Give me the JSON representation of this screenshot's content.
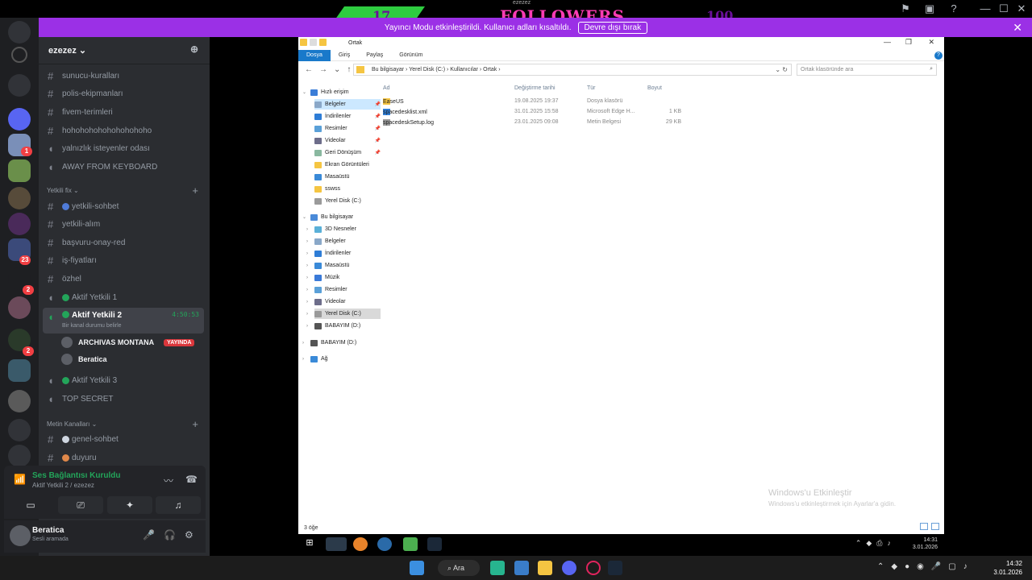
{
  "overlay": {
    "left_count": "17",
    "title": "FOLLOWERS",
    "tag": "ezezez",
    "right_count": "100"
  },
  "notice": {
    "text": "Yayıncı Modu etkinleştirildi. Kullanıcı adları kısaltıldı.",
    "button": "Devre dışı bırak"
  },
  "server": {
    "name": "ezezez"
  },
  "channels": [
    {
      "name": "sunucu-kuralları",
      "type": "text"
    },
    {
      "name": "polis-ekipmanları",
      "type": "text"
    },
    {
      "name": "fivem-terimleri",
      "type": "text"
    },
    {
      "name": "hohohohohohohohohoho",
      "type": "text"
    },
    {
      "name": "yalnızlık isteyenler odası",
      "type": "voice"
    },
    {
      "name": "AWAY FROM KEYBOARD",
      "type": "voice"
    }
  ],
  "category1": "Yetkili fix",
  "channels2": [
    {
      "name": "yetkili-sohbet",
      "type": "text"
    },
    {
      "name": "yetkili-alım",
      "type": "text"
    },
    {
      "name": "başvuru-onay-red",
      "type": "text"
    },
    {
      "name": "iş-fiyatları",
      "type": "text"
    },
    {
      "name": "özhel",
      "type": "text"
    },
    {
      "name": "Aktif Yetkili 1",
      "type": "voice"
    }
  ],
  "active_channel": {
    "name": "Aktif Yetkili 2",
    "time": "4:50:53",
    "status": "Bir kanal durumu belirle"
  },
  "members": [
    {
      "name": "ARCHIVAS MONTANA",
      "live": "YAYINDA"
    },
    {
      "name": "Beratica",
      "live": ""
    }
  ],
  "channels3": [
    {
      "name": "Aktif Yetkili 3",
      "type": "voice"
    },
    {
      "name": "TOP SECRET",
      "type": "voice"
    }
  ],
  "category2": "Metin Kanalları",
  "channels4": [
    {
      "name": "genel-sohbet",
      "type": "text"
    },
    {
      "name": "duyuru",
      "type": "text"
    }
  ],
  "voice_panel": {
    "status": "Ses Bağlantısı Kuruldu",
    "where": "Aktif Yetkili 2 / ezezez"
  },
  "user": {
    "name": "Beratica",
    "status": "Sesli aramada"
  },
  "rail_badges": [
    "1",
    "23",
    "2",
    "2"
  ],
  "explorer": {
    "title": "Ortak",
    "tabs": [
      "Dosya",
      "Giriş",
      "Paylaş",
      "Görünüm"
    ],
    "path": [
      "Bu bilgisayar",
      "Yerel Disk (C:)",
      "Kullanıcılar",
      "Ortak"
    ],
    "search_placeholder": "Ortak klasöründe ara",
    "quick_access_label": "Hızlı erişim",
    "quick_access": [
      {
        "label": "Belgeler",
        "pinned": true
      },
      {
        "label": "İndirilenler",
        "pinned": true
      },
      {
        "label": "Resimler",
        "pinned": true
      },
      {
        "label": "Videolar",
        "pinned": true
      },
      {
        "label": "Geri Dönüşüm",
        "pinned": true
      },
      {
        "label": "Ekran Görüntüleri",
        "pinned": false
      },
      {
        "label": "Masaüstü",
        "pinned": false
      },
      {
        "label": "sswss",
        "pinned": false
      },
      {
        "label": "Yerel Disk (C:)",
        "pinned": false
      }
    ],
    "this_pc_label": "Bu bilgisayar",
    "this_pc": [
      "3D Nesneler",
      "Belgeler",
      "İndirilenler",
      "Masaüstü",
      "Müzik",
      "Resimler",
      "Videolar",
      "Yerel Disk (C:)",
      "BABAYIM (D:)"
    ],
    "drive_root": "BABAYIM (D:)",
    "network": "Ağ",
    "columns": [
      "Ad",
      "Değiştirme tarihi",
      "Tür",
      "Boyut"
    ],
    "files": [
      {
        "name": "EaseUS",
        "date": "19.08.2025 19:37",
        "type": "Dosya klasörü",
        "size": ""
      },
      {
        "name": "spacedesklist.xml",
        "date": "31.01.2025 15:58",
        "type": "Microsoft Edge H...",
        "size": "1 KB"
      },
      {
        "name": "spacedeskSetup.log",
        "date": "23.01.2025 09:08",
        "type": "Metin Belgesi",
        "size": "29 KB"
      }
    ],
    "status": "3 öğe",
    "activate_title": "Windows'u Etkinleştir",
    "activate_sub": "Windows'u etkinleştirmek için Ayarlar'a gidin."
  },
  "inner_clock": {
    "time": "14:31",
    "date": "3.01.2026"
  },
  "taskbar": {
    "search": "Ara",
    "time": "14:32",
    "date": "3.01.2026"
  },
  "colors": {
    "discord_bg": "#2b2d31",
    "banner": "#9b30e6",
    "connected": "#23a55a",
    "live": "#da373c"
  }
}
